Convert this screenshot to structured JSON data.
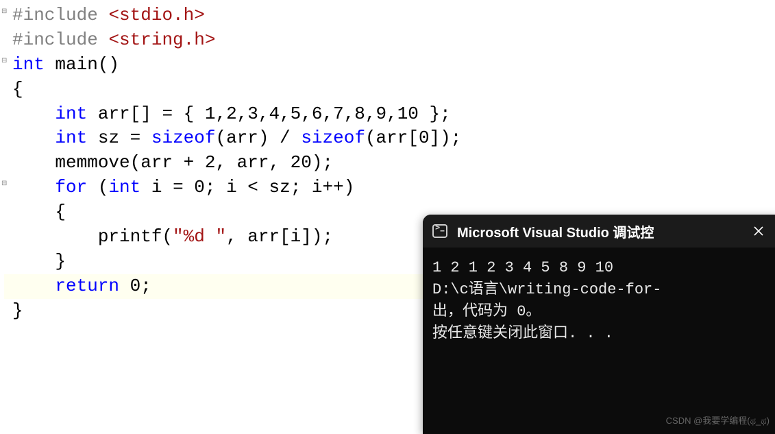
{
  "code": {
    "lines": [
      {
        "fold": "⊟",
        "segments": [
          {
            "t": "#include ",
            "c": "preproc"
          },
          {
            "t": "<stdio.h>",
            "c": "str-include"
          }
        ]
      },
      {
        "fold": "",
        "segments": [
          {
            "t": "#include ",
            "c": "preproc"
          },
          {
            "t": "<string.h>",
            "c": "str-include"
          }
        ]
      },
      {
        "fold": "⊟",
        "segments": [
          {
            "t": "int",
            "c": "kw"
          },
          {
            "t": " main()",
            "c": "ident"
          }
        ]
      },
      {
        "fold": "",
        "segments": [
          {
            "t": "{",
            "c": "ident"
          }
        ]
      },
      {
        "fold": "",
        "segments": [
          {
            "t": "    ",
            "c": ""
          },
          {
            "t": "int",
            "c": "kw"
          },
          {
            "t": " arr[] = { 1,2,3,4,5,6,7,8,9,10 };",
            "c": "ident"
          }
        ]
      },
      {
        "fold": "",
        "segments": [
          {
            "t": "    ",
            "c": ""
          },
          {
            "t": "int",
            "c": "kw"
          },
          {
            "t": " sz = ",
            "c": "ident"
          },
          {
            "t": "sizeof",
            "c": "sizeof"
          },
          {
            "t": "(arr) / ",
            "c": "ident"
          },
          {
            "t": "sizeof",
            "c": "sizeof"
          },
          {
            "t": "(arr[0]);",
            "c": "ident"
          }
        ]
      },
      {
        "fold": "",
        "segments": [
          {
            "t": "    memmove(arr + 2, arr, 20);",
            "c": "ident"
          }
        ]
      },
      {
        "fold": "⊟",
        "segments": [
          {
            "t": "    ",
            "c": ""
          },
          {
            "t": "for",
            "c": "kw"
          },
          {
            "t": " (",
            "c": "ident"
          },
          {
            "t": "int",
            "c": "kw"
          },
          {
            "t": " i = 0; i < sz; i++)",
            "c": "ident"
          }
        ]
      },
      {
        "fold": "",
        "segments": [
          {
            "t": "    {",
            "c": "ident"
          }
        ]
      },
      {
        "fold": "",
        "segments": [
          {
            "t": "        printf(",
            "c": "ident"
          },
          {
            "t": "\"%d \"",
            "c": "str"
          },
          {
            "t": ", arr[i]);",
            "c": "ident"
          }
        ]
      },
      {
        "fold": "",
        "segments": [
          {
            "t": "    }",
            "c": "ident"
          }
        ]
      },
      {
        "fold": "",
        "hl": true,
        "segments": [
          {
            "t": "    ",
            "c": ""
          },
          {
            "t": "return",
            "c": "return-kw"
          },
          {
            "t": " 0;",
            "c": "ident"
          }
        ]
      },
      {
        "fold": "",
        "segments": [
          {
            "t": "}",
            "c": "ident"
          }
        ]
      }
    ]
  },
  "terminal": {
    "title": "Microsoft Visual Studio 调试控",
    "output_line1": "1 2 1 2 3 4 5 8 9 10",
    "output_line2": "D:\\c语言\\writing-code-for-",
    "output_line3": "出，代码为 0。",
    "output_line4": "按任意键关闭此窗口. . ."
  },
  "watermark": "CSDN @我要学编程(ಥ_ಥ)"
}
